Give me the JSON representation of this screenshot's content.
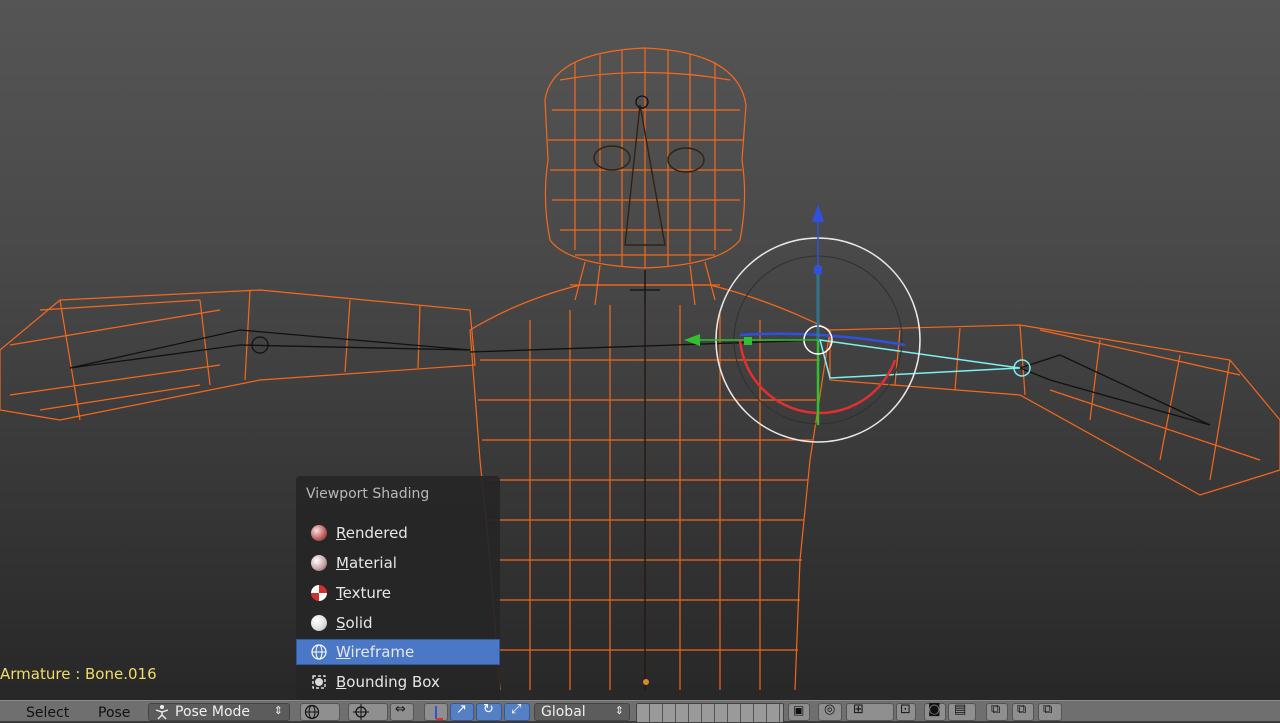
{
  "viewport": {
    "object_info": "Armature : Bone.016"
  },
  "shading_menu": {
    "title": "Viewport Shading",
    "items": [
      {
        "label": "Rendered",
        "icon": "rendered-sphere-icon",
        "active": false
      },
      {
        "label": "Material",
        "icon": "material-sphere-icon",
        "active": false
      },
      {
        "label": "Texture",
        "icon": "texture-checker-icon",
        "active": false
      },
      {
        "label": "Solid",
        "icon": "solid-sphere-icon",
        "active": false
      },
      {
        "label": "Wireframe",
        "icon": "wireframe-globe-icon",
        "active": true
      },
      {
        "label": "Bounding Box",
        "icon": "bounding-box-icon",
        "active": false
      }
    ]
  },
  "header": {
    "select_label": "Select",
    "pose_label": "Pose",
    "mode_label": "Pose Mode",
    "orientation_label": "Global"
  },
  "colors": {
    "wire_selected": "#ff6a1a",
    "menu_highlight": "#4a78c6",
    "info_text": "#f2dc6a",
    "axis_x": "#e03030",
    "axis_y": "#30c030",
    "axis_z": "#3050e0",
    "bone_active": "#7ff0f0"
  }
}
